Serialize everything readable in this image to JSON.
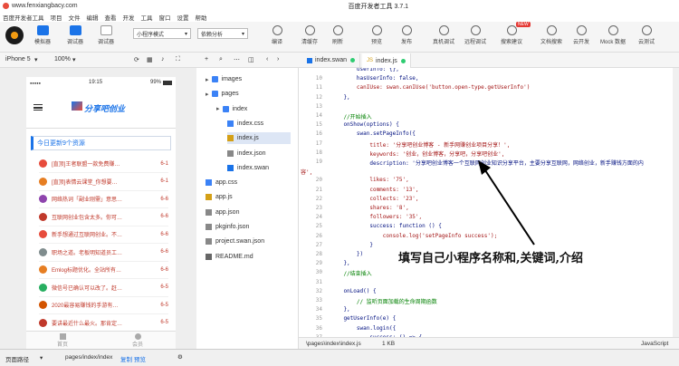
{
  "title_bar": {
    "url": "www.fenxiangbacy.com",
    "title": "百度开发者工具 3.7.1"
  },
  "menu": [
    "百度开发者工具",
    "项目",
    "文件",
    "编辑",
    "查看",
    "开发",
    "工具",
    "窗口",
    "设置",
    "帮助"
  ],
  "toolbar": {
    "simulator": "模拟器",
    "debugger": "调试器",
    "tuner": "调试器",
    "mode_select": "小程序模式",
    "dep_select": "依赖分析",
    "compile": "编译",
    "clear_cache": "清缓存",
    "refresh": "刷新",
    "preview": "预览",
    "publish": "发布",
    "real_debug": "真机调试",
    "remote_debug": "远程调试",
    "search_suggest": "搜索建议",
    "new_badge": "NEW",
    "doc_search": "文档搜索",
    "cloud_dev": "云开发",
    "mock": "Mock 数据",
    "cloud_test": "云测试"
  },
  "device_bar": {
    "device": "iPhone 5",
    "zoom": "100%"
  },
  "tabs": [
    "index.swan",
    "index.js"
  ],
  "phone": {
    "time": "19:15",
    "battery": "99%",
    "signal": "●●●●●",
    "logo_text": "分享吧创业",
    "section_title": "今日更新9个资源",
    "items": [
      {
        "title": "[直顶]王者联盟一款免费赚…",
        "date": "6-1",
        "color": "#e74c3c"
      },
      {
        "title": "[直顶]表情云课堂_你想要…",
        "date": "6-1",
        "color": "#e67e22"
      },
      {
        "title": "网络热词「副业刚需」意思…",
        "date": "6-6",
        "color": "#8e44ad"
      },
      {
        "title": "互联网创业包含太多。你可…",
        "date": "6-6",
        "color": "#c0392b"
      },
      {
        "title": "新手想通过互联网创业。不…",
        "date": "6-6",
        "color": "#e74c3c"
      },
      {
        "title": "职场之道。老板明知道员工…",
        "date": "6-6",
        "color": "#7f8c8d"
      },
      {
        "title": "Emlog标题优化。全站所有…",
        "date": "6-6",
        "color": "#e67e22"
      },
      {
        "title": "微信号已确认可以改了。赶…",
        "date": "6-5",
        "color": "#27ae60"
      },
      {
        "title": "2020最容易赚钱的手游有…",
        "date": "6-5",
        "color": "#d35400"
      },
      {
        "title": "要讲最近什么最火。那肯定…",
        "date": "6-5",
        "color": "#c0392b"
      }
    ],
    "tab_home": "首页",
    "tab_member": "会员"
  },
  "files": [
    {
      "name": "images",
      "type": "folder",
      "depth": 0
    },
    {
      "name": "pages",
      "type": "folder",
      "depth": 0
    },
    {
      "name": "index",
      "type": "folder",
      "depth": 1
    },
    {
      "name": "index.css",
      "type": "css",
      "depth": 2
    },
    {
      "name": "index.js",
      "type": "js",
      "depth": 2
    },
    {
      "name": "index.json",
      "type": "json",
      "depth": 2
    },
    {
      "name": "index.swan",
      "type": "swan",
      "depth": 2
    },
    {
      "name": "app.css",
      "type": "css",
      "depth": 0
    },
    {
      "name": "app.js",
      "type": "js",
      "depth": 0
    },
    {
      "name": "app.json",
      "type": "json",
      "depth": 0
    },
    {
      "name": "pkginfo.json",
      "type": "json",
      "depth": 0
    },
    {
      "name": "project.swan.json",
      "type": "json",
      "depth": 0
    },
    {
      "name": "README.md",
      "type": "md",
      "depth": 0
    }
  ],
  "code_lines": [
    {
      "n": "",
      "t": "        userInfo: {},"
    },
    {
      "n": "10",
      "t": "        hasUserInfo: false,"
    },
    {
      "n": "11",
      "t": "        canIUse: swan.canIUse('button.open-type.getUserInfo')"
    },
    {
      "n": "12",
      "t": "    },"
    },
    {
      "n": "13",
      "t": ""
    },
    {
      "n": "14",
      "t": "    //开始插入"
    },
    {
      "n": "15",
      "t": "    onShow(options) {"
    },
    {
      "n": "16",
      "t": "        swan.setPageInfo({"
    },
    {
      "n": "17",
      "t": "            title: '分享吧创业博客 - 新手网赚创业项目分享！',"
    },
    {
      "n": "18",
      "t": "            keywords: '创业，创业博客，分享吧，分享吧创业',"
    },
    {
      "n": "19",
      "t": "            description: '分享吧创业博客一个互联网创业知识分享平台，主要分享互联网，网络创业，新手赚钱方面的内"
    },
    {
      "n": "",
      "t": "容',"
    },
    {
      "n": "20",
      "t": "            likes: '75',"
    },
    {
      "n": "21",
      "t": "            comments: '13',"
    },
    {
      "n": "22",
      "t": "            collects: '23',"
    },
    {
      "n": "23",
      "t": "            shares: '8',"
    },
    {
      "n": "24",
      "t": "            followers: '35',"
    },
    {
      "n": "25",
      "t": "            success: function () {"
    },
    {
      "n": "26",
      "t": "                console.log('setPageInfo success');"
    },
    {
      "n": "27",
      "t": "            }"
    },
    {
      "n": "28",
      "t": "        })"
    },
    {
      "n": "29",
      "t": "    },"
    },
    {
      "n": "30",
      "t": "    //结束插入"
    },
    {
      "n": "31",
      "t": ""
    },
    {
      "n": "32",
      "t": "    onLoad() {"
    },
    {
      "n": "33",
      "t": "        // 监听页面加载的生命周期函数"
    },
    {
      "n": "34",
      "t": "    },"
    },
    {
      "n": "35",
      "t": "    getUserInfo(e) {"
    },
    {
      "n": "36",
      "t": "        swan.login({"
    },
    {
      "n": "37",
      "t": "            success: () => {"
    }
  ],
  "annotation": "填写自己小程序名称和,关键词,介绍",
  "status": {
    "path": "\\pages\\index\\index.js",
    "size": "1 KB",
    "lang": "JavaScript"
  },
  "bottom": {
    "label": "页面路径",
    "path": "pages/index/index",
    "copy": "复制",
    "preview": "预览"
  }
}
